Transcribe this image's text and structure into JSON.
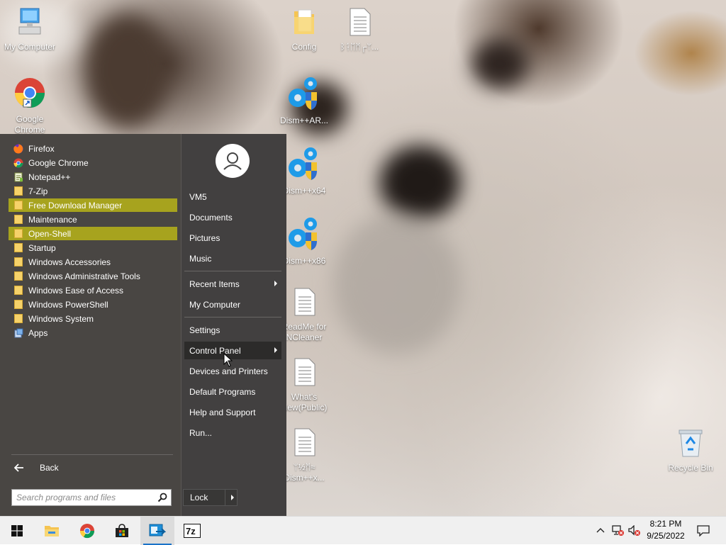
{
  "desktop": {
    "icons": [
      {
        "name": "My Computer",
        "icon": "computer-icon"
      },
      {
        "name": "Google Chrome",
        "icon": "chrome-shortcut-icon"
      },
      {
        "name": "Config",
        "icon": "folder-icon"
      },
      {
        "name": "ᛒᛑᛖᛗ┌ᛘ...",
        "icon": "text-file-icon"
      },
      {
        "name": "Dism++AR...",
        "icon": "dism-gear-shield-icon"
      },
      {
        "name": "Dism++x64",
        "icon": "dism-gear-shield-icon"
      },
      {
        "name": "Dism++x86",
        "icon": "dism-gear-shield-icon"
      },
      {
        "name": "ReadMe for NCleaner",
        "icon": "text-file-icon"
      },
      {
        "name": "What's New(Public)",
        "icon": "text-file-icon"
      },
      {
        "name": "ᛘ½ᛗ≈ Dism++x...",
        "icon": "text-file-icon"
      },
      {
        "name": "Recycle Bin",
        "icon": "recycle-bin-icon"
      }
    ]
  },
  "start_menu": {
    "programs": [
      {
        "label": "Firefox",
        "icon": "firefox-icon"
      },
      {
        "label": "Google Chrome",
        "icon": "chrome-icon"
      },
      {
        "label": "Notepad++",
        "icon": "notepad-plus-plus-icon"
      },
      {
        "label": "7-Zip",
        "icon": "folder-icon"
      },
      {
        "label": "Free Download Manager",
        "icon": "folder-icon",
        "highlighted": true
      },
      {
        "label": "Maintenance",
        "icon": "folder-icon"
      },
      {
        "label": "Open-Shell",
        "icon": "folder-icon",
        "highlighted": true
      },
      {
        "label": "Startup",
        "icon": "folder-icon"
      },
      {
        "label": "Windows Accessories",
        "icon": "folder-icon"
      },
      {
        "label": "Windows Administrative Tools",
        "icon": "folder-icon"
      },
      {
        "label": "Windows Ease of Access",
        "icon": "folder-icon"
      },
      {
        "label": "Windows PowerShell",
        "icon": "folder-icon"
      },
      {
        "label": "Windows System",
        "icon": "folder-icon"
      },
      {
        "label": "Apps",
        "icon": "apps-icon"
      }
    ],
    "back_label": "Back",
    "search_placeholder": "Search programs and files",
    "user_name": "VM5",
    "places": [
      {
        "label": "Documents"
      },
      {
        "label": "Pictures"
      },
      {
        "label": "Music"
      },
      {
        "label": "Recent Items",
        "submenu": true
      },
      {
        "label": "My Computer"
      },
      {
        "label": "Settings"
      },
      {
        "label": "Control Panel",
        "submenu": true,
        "hovered": true
      },
      {
        "label": "Devices and Printers"
      },
      {
        "label": "Default Programs"
      },
      {
        "label": "Help and Support"
      },
      {
        "label": "Run..."
      }
    ],
    "lock_label": "Lock",
    "colors": {
      "highlight": "#a7a31e",
      "menu_bg": "#494643",
      "hover_bg": "#2c2b2a"
    }
  },
  "taskbar": {
    "pinned": [
      {
        "name": "start-button",
        "icon": "windows-logo-icon"
      },
      {
        "name": "file-explorer",
        "icon": "file-explorer-icon"
      },
      {
        "name": "chrome",
        "icon": "chrome-icon"
      },
      {
        "name": "microsoft-store",
        "icon": "store-icon"
      },
      {
        "name": "open-shell",
        "icon": "open-shell-icon",
        "active": true
      },
      {
        "name": "7-zip",
        "icon": "7zip-icon"
      }
    ],
    "time": "8:21 PM",
    "date": "9/25/2022"
  }
}
